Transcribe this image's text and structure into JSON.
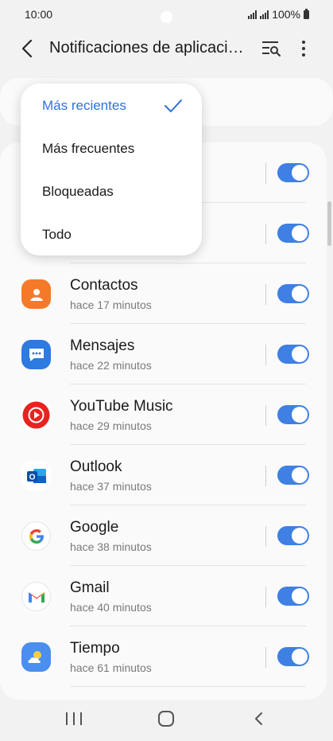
{
  "status": {
    "time": "10:00",
    "battery": "100%"
  },
  "header": {
    "title": "Notificaciones de aplicaciones"
  },
  "sort_menu": {
    "options": [
      "Más recientes",
      "Más frecuentes",
      "Bloqueadas",
      "Todo"
    ],
    "selected": "Más recientes"
  },
  "apps": [
    {
      "name": "Contactos",
      "time": "hace 17 minutos",
      "icon": "contacts-icon",
      "enabled": true
    },
    {
      "name": "Mensajes",
      "time": "hace 22 minutos",
      "icon": "messages-icon",
      "enabled": true
    },
    {
      "name": "YouTube Music",
      "time": "hace 29 minutos",
      "icon": "youtube-music-icon",
      "enabled": true
    },
    {
      "name": "Outlook",
      "time": "hace 37 minutos",
      "icon": "outlook-icon",
      "enabled": true
    },
    {
      "name": "Google",
      "time": "hace 38 minutos",
      "icon": "google-icon",
      "enabled": true
    },
    {
      "name": "Gmail",
      "time": "hace 40 minutos",
      "icon": "gmail-icon",
      "enabled": true
    },
    {
      "name": "Tiempo",
      "time": "hace 61 minutos",
      "icon": "weather-icon",
      "enabled": true
    }
  ],
  "colors": {
    "accent": "#3e80e3",
    "selected_text": "#2f71d8",
    "background": "#f2f2f2"
  }
}
